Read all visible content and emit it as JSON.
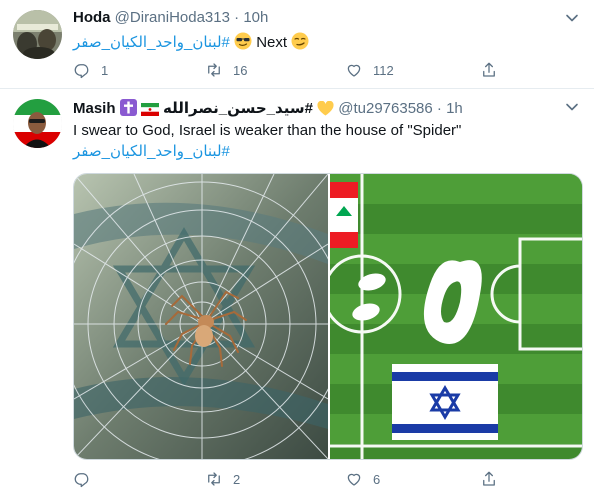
{
  "tweets": [
    {
      "name": "Hoda",
      "handle": "@DiraniHoda313",
      "separator": "·",
      "time": "10h",
      "text_hashtag": "#لبنان_واحد_الكيان_صفر",
      "text_suffix": "Next",
      "emoji_1": "sunglasses-face",
      "emoji_2": "smirking-face",
      "replies": "1",
      "retweets": "16",
      "likes": "112"
    },
    {
      "name": "Masih",
      "name_suffix": "#سيد_حسن_نصرالله",
      "handle": "@tu29763586",
      "separator": "·",
      "time": "1h",
      "text": "I swear to God, Israel is weaker than the house of \"Spider\"",
      "hashtag": "#لبنان_واحد_الكيان_صفر",
      "replies": "",
      "retweets": "2",
      "likes": "6"
    }
  ],
  "colors": {
    "accent": "#1b95e0",
    "muted": "#5b7083",
    "text": "#0f1419",
    "divider": "#e6ecf0"
  },
  "media": {
    "left": "spider-web-over-israeli-flag",
    "right": "football-pitch-scoreboard",
    "score_left_team": "lebanon-flag",
    "score_right_team": "israel-flag"
  }
}
